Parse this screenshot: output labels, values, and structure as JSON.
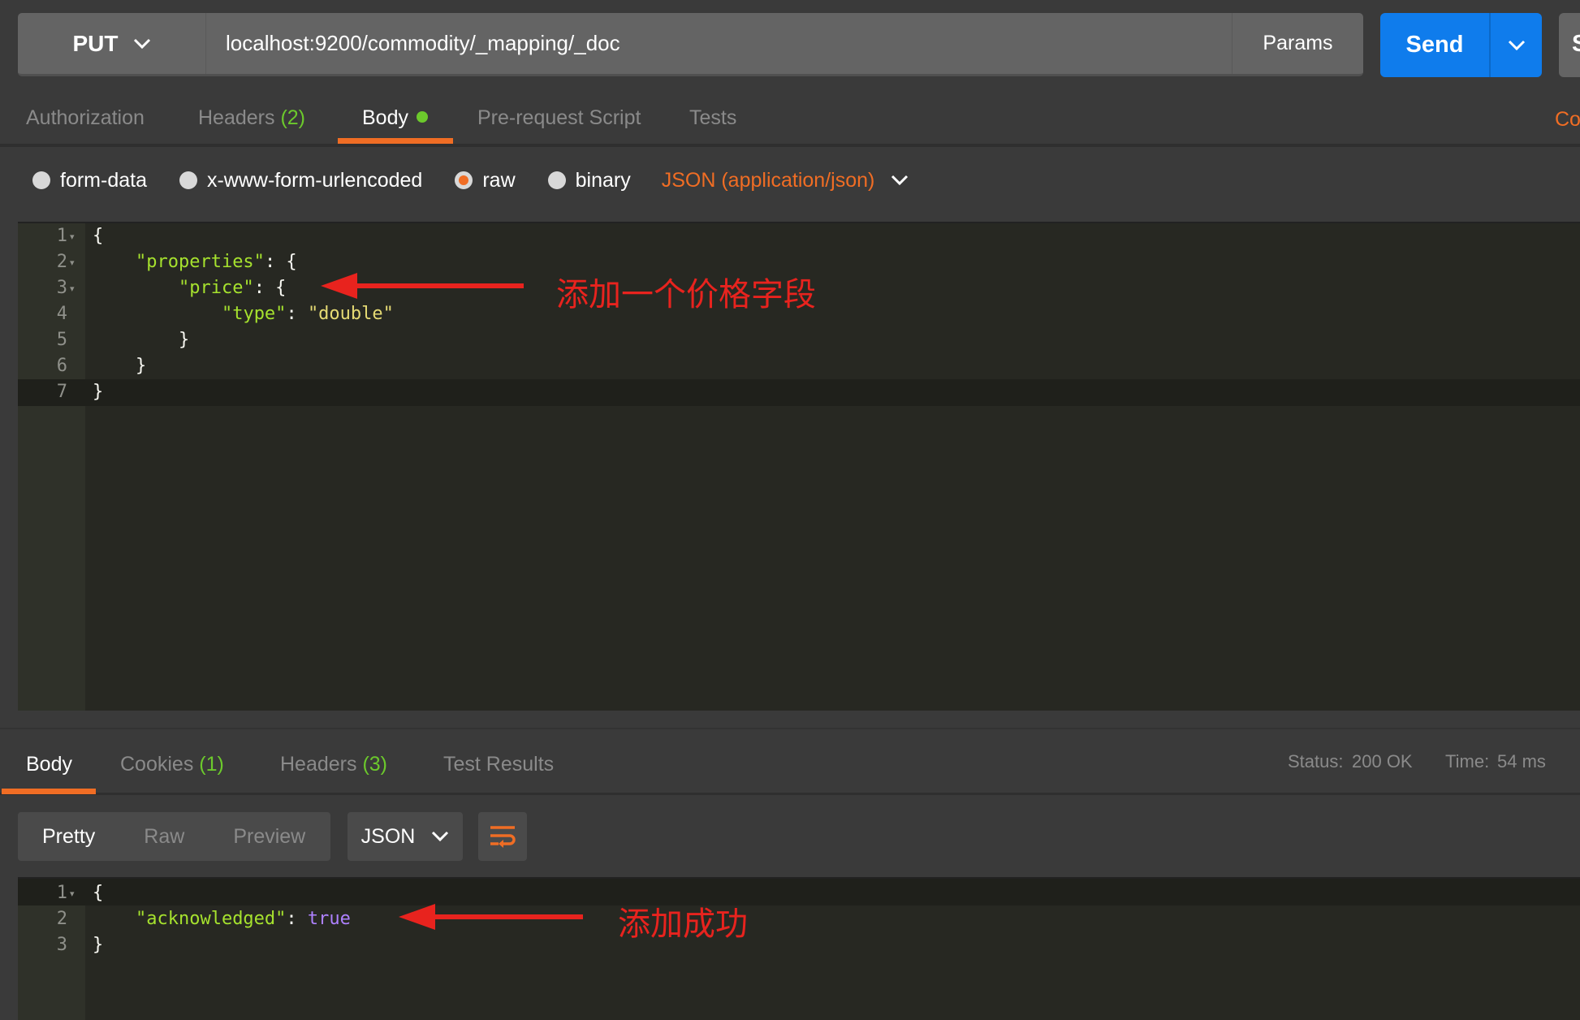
{
  "request": {
    "method": "PUT",
    "url": "localhost:9200/commodity/_mapping/_doc",
    "params_label": "Params",
    "send_label": "Send",
    "save_label_partial": "S"
  },
  "request_tabs": [
    {
      "label": "Authorization"
    },
    {
      "label": "Headers",
      "count": "(2)"
    },
    {
      "label": "Body"
    },
    {
      "label": "Pre-request Script"
    },
    {
      "label": "Tests"
    }
  ],
  "cookies_link_partial": "Co",
  "body_types": [
    "form-data",
    "x-www-form-urlencoded",
    "raw",
    "binary"
  ],
  "body_type_selected": "raw",
  "content_type": "JSON (application/json)",
  "request_body_lines": [
    "1",
    "2",
    "3",
    "4",
    "5",
    "6",
    "7"
  ],
  "annotation_request": "添加一个价格字段",
  "response_tabs": [
    {
      "label": "Body"
    },
    {
      "label": "Cookies",
      "count": "(1)"
    },
    {
      "label": "Headers",
      "count": "(3)"
    },
    {
      "label": "Test Results"
    }
  ],
  "response_status": {
    "status_label": "Status:",
    "status_value": "200 OK",
    "time_label": "Time:",
    "time_value": "54 ms"
  },
  "response_view": {
    "modes": [
      "Pretty",
      "Raw",
      "Preview"
    ],
    "selected": "Pretty",
    "format": "JSON"
  },
  "response_body_lines": [
    "1",
    "2",
    "3"
  ],
  "annotation_response": "添加成功",
  "colors": {
    "accent": "#f06d24",
    "send": "#0f7cec",
    "success": "#6cc92c",
    "annotation": "#e8231e"
  }
}
